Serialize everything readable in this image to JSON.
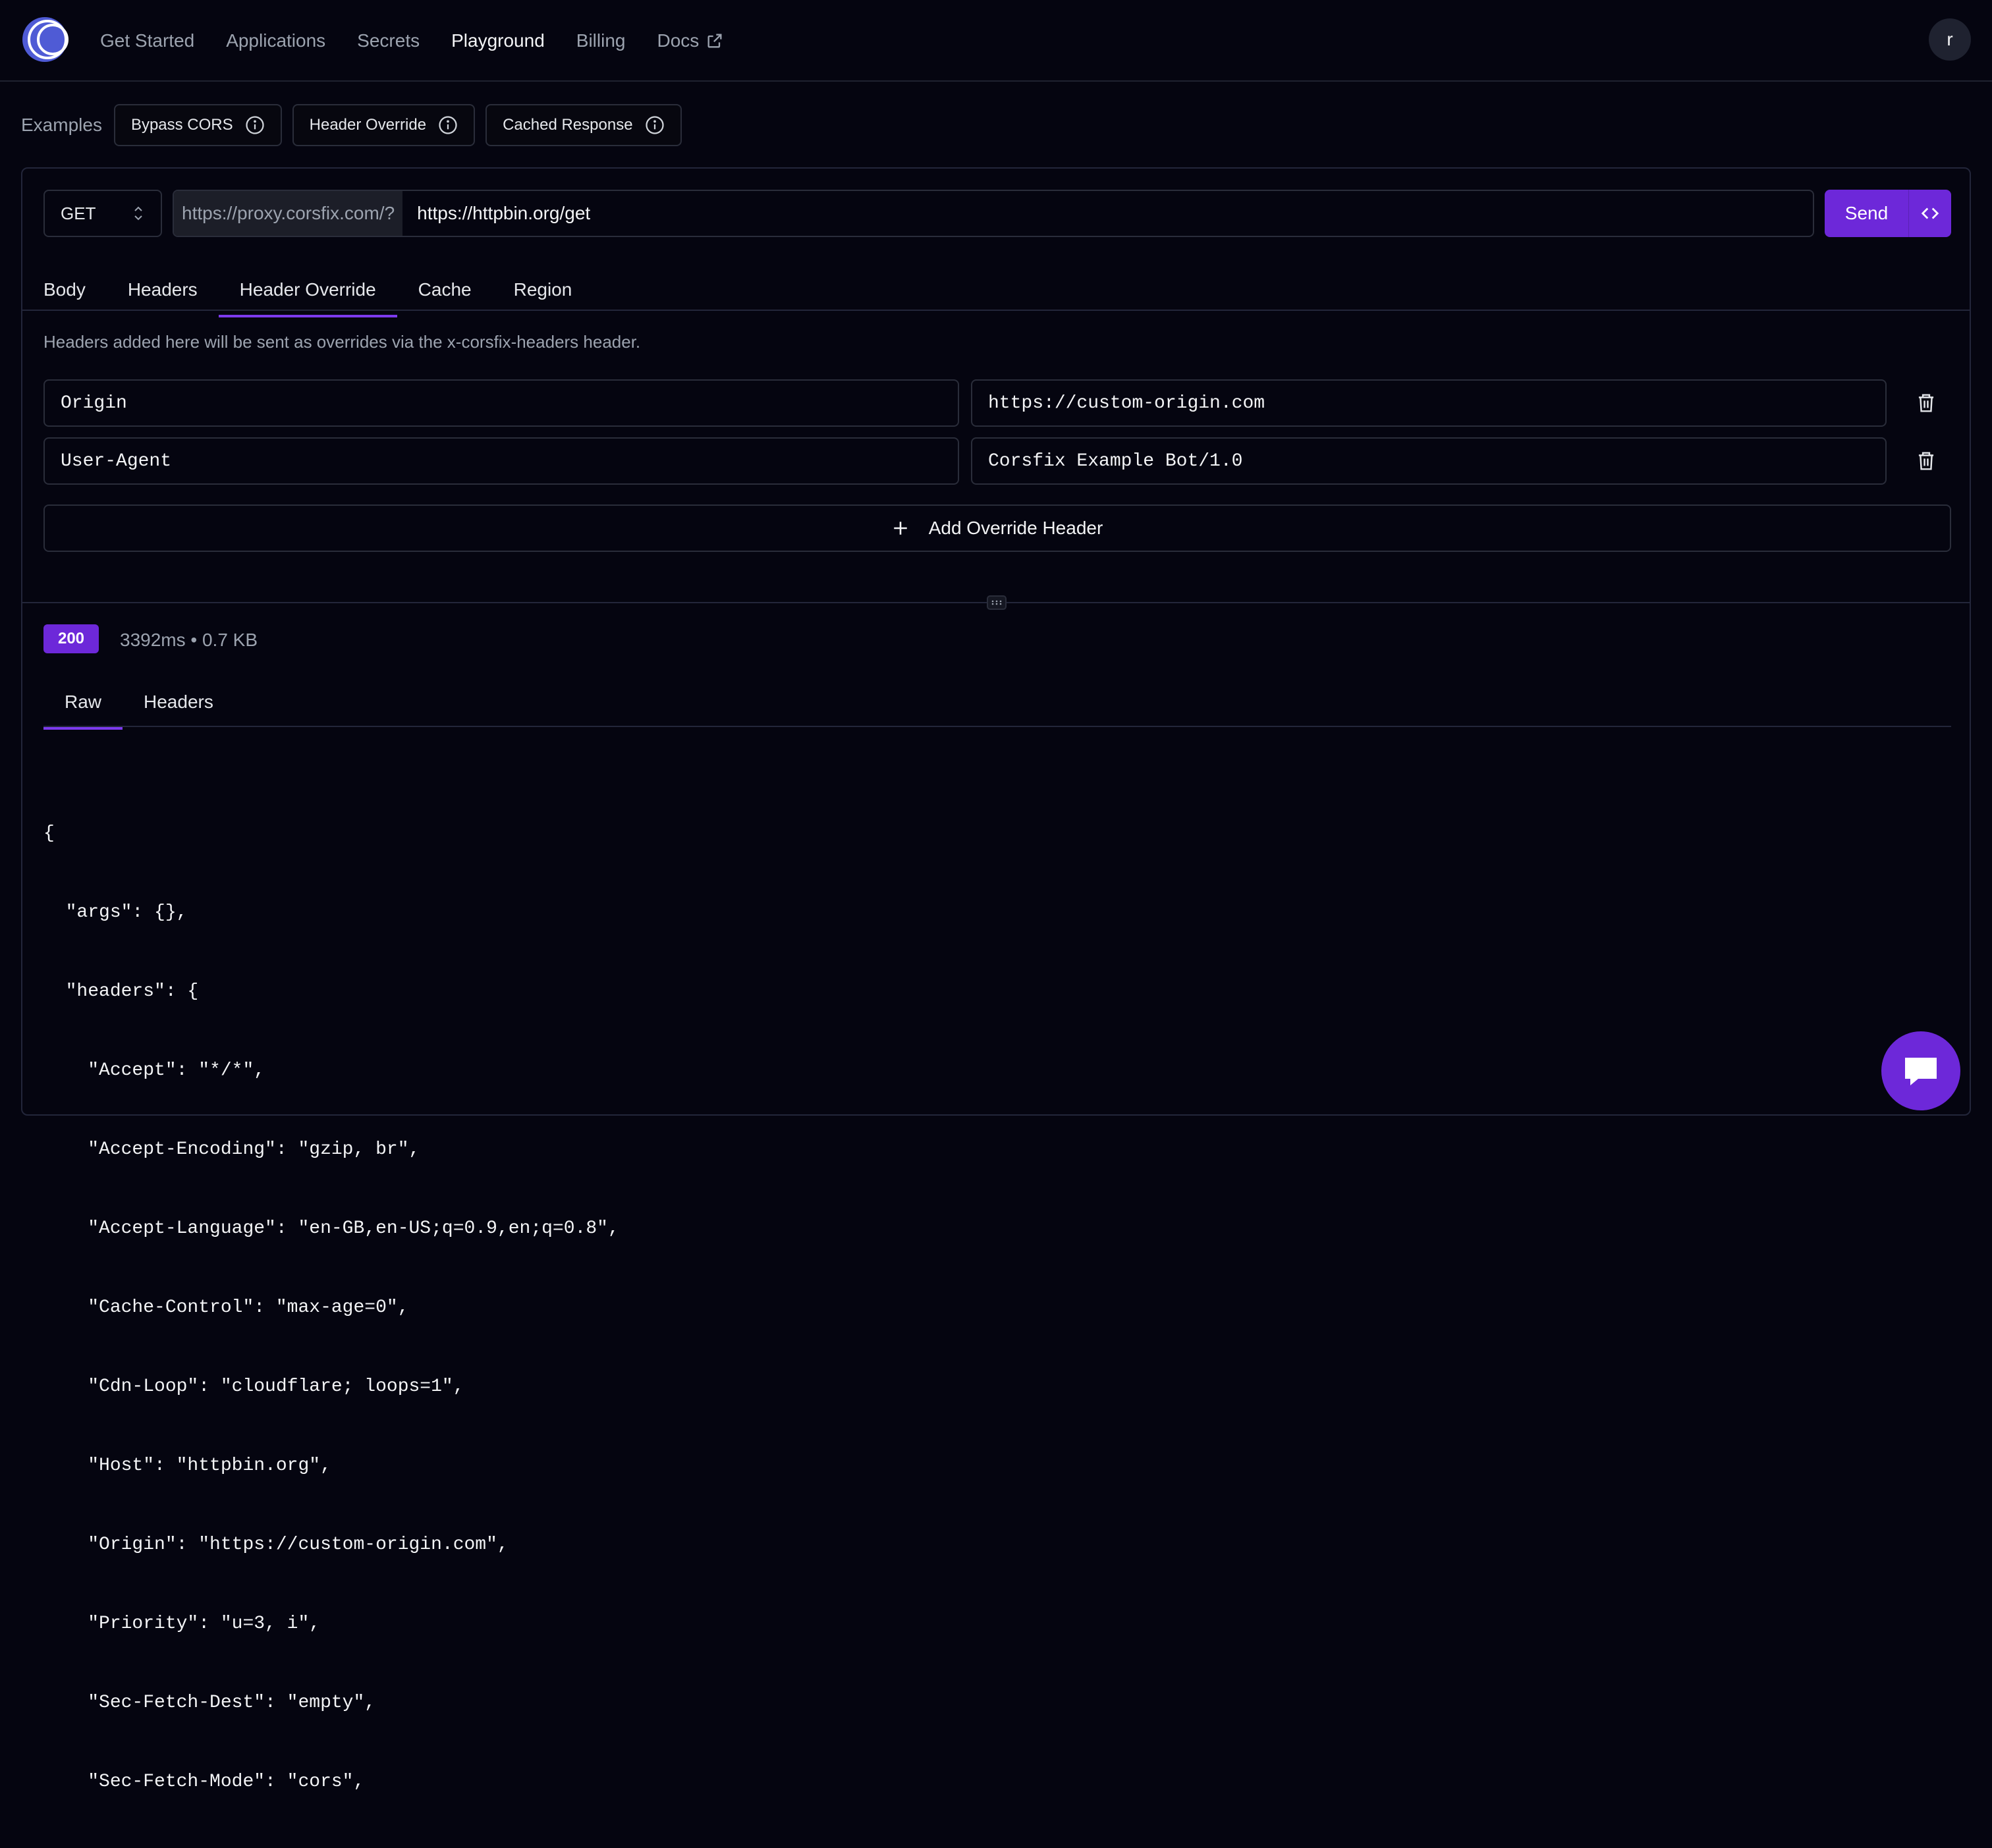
{
  "nav": {
    "links": [
      "Get Started",
      "Applications",
      "Secrets",
      "Playground",
      "Billing",
      "Docs"
    ],
    "active": "Playground",
    "avatar_initial": "r"
  },
  "examples": {
    "label": "Examples",
    "chips": [
      "Bypass CORS",
      "Header Override",
      "Cached Response"
    ]
  },
  "request": {
    "method": "GET",
    "proxy_prefix": "https://proxy.corsfix.com/?",
    "url": "https://httpbin.org/get",
    "send_label": "Send"
  },
  "request_tabs": [
    "Body",
    "Headers",
    "Header Override",
    "Cache",
    "Region"
  ],
  "active_request_tab": "Header Override",
  "override": {
    "hint": "Headers added here will be sent as overrides via the x-corsfix-headers header.",
    "rows": [
      {
        "key": "Origin",
        "value": "https://custom-origin.com"
      },
      {
        "key": "User-Agent",
        "value": "Corsfix Example Bot/1.0"
      }
    ],
    "add_label": "Add Override Header"
  },
  "response": {
    "status": "200",
    "meta": "3392ms • 0.7 KB",
    "tabs": [
      "Raw",
      "Headers"
    ],
    "active_tab": "Raw",
    "body_lines": [
      "{",
      "  \"args\": {},",
      "  \"headers\": {",
      "    \"Accept\": \"*/*\",",
      "    \"Accept-Encoding\": \"gzip, br\",",
      "    \"Accept-Language\": \"en-GB,en-US;q=0.9,en;q=0.8\",",
      "    \"Cache-Control\": \"max-age=0\",",
      "    \"Cdn-Loop\": \"cloudflare; loops=1\",",
      "    \"Host\": \"httpbin.org\",",
      "    \"Origin\": \"https://custom-origin.com\",",
      "    \"Priority\": \"u=3, i\",",
      "    \"Sec-Fetch-Dest\": \"empty\",",
      "    \"Sec-Fetch-Mode\": \"cors\","
    ]
  },
  "colors": {
    "background": "#050510",
    "accent": "#6d28d9",
    "border": "#2a2d3a"
  }
}
